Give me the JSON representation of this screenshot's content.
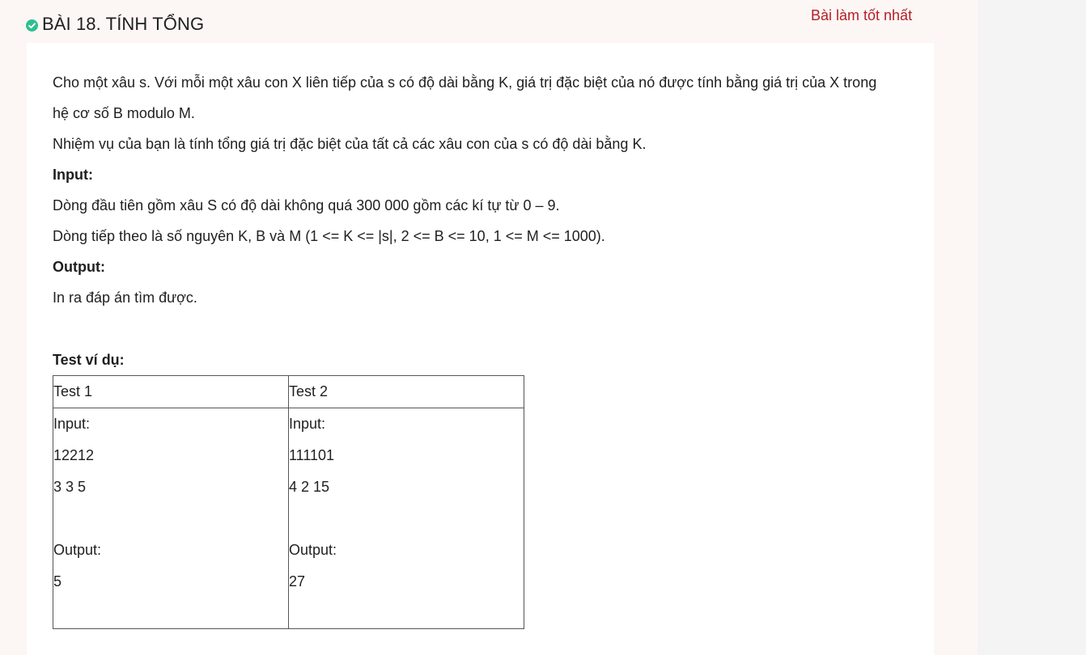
{
  "header": {
    "title": "BÀI 18. TÍNH TỔNG",
    "best_link": "Bài làm tốt nhất",
    "status_icon": "check-circle-icon",
    "accent_color": "#b32025",
    "check_color": "#2ebf91"
  },
  "problem": {
    "paragraphs": [
      "Cho một xâu s. Với mỗi một xâu con X liên tiếp của s có độ dài bằng K, giá trị đặc biệt của nó được tính bằng giá trị của X trong",
      "hệ cơ số B modulo M.",
      "Nhiệm vụ của bạn là tính tổng giá trị đặc biệt của tất cả các xâu con của s có độ dài bằng K."
    ],
    "input_heading": "Input:",
    "input_lines": [
      "Dòng đầu tiên gồm xâu S có độ dài không quá 300 000 gồm các kí tự từ 0 – 9.",
      "Dòng tiếp theo là số nguyên K, B và M (1 <= K <= |s|, 2 <= B <= 10, 1 <= M <= 1000)."
    ],
    "output_heading": "Output:",
    "output_lines": [
      "In ra đáp án tìm được."
    ],
    "examples_heading": "Test ví dụ:"
  },
  "tests": [
    {
      "title": "Test 1",
      "input_label": "Input:",
      "input_line1": "12212",
      "input_line2": "3 3 5",
      "output_label": "Output:",
      "output_value": "5"
    },
    {
      "title": "Test 2",
      "input_label": "Input:",
      "input_line1": "111101",
      "input_line2": "4 2 15",
      "output_label": "Output:",
      "output_value": "27"
    }
  ]
}
